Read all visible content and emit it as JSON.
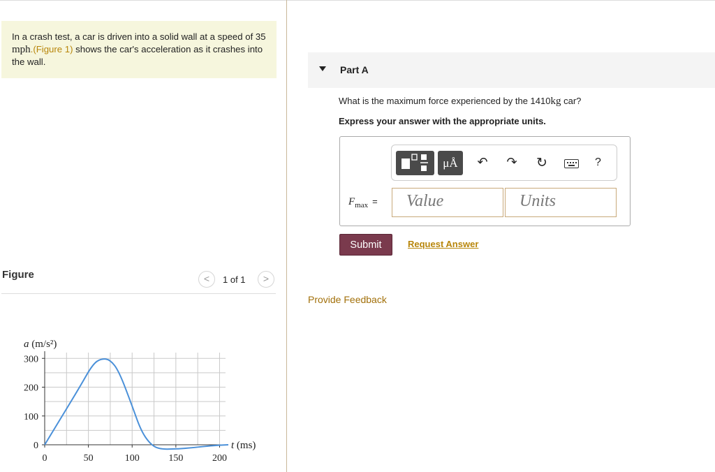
{
  "problem": {
    "text_part1": "In a crash test, a car is driven into a solid wall at a speed of 35 ",
    "speed_unit": "mph",
    "figure_link": ".(Figure 1)",
    "text_part2": " shows the car's acceleration as it crashes into the wall."
  },
  "figure": {
    "label": "Figure",
    "pager": "1 of 1",
    "prev_symbol": "<",
    "next_symbol": ">"
  },
  "part": {
    "title": "Part A",
    "question_pre": "What is the maximum force experienced by the 1410",
    "question_unit": "kg",
    "question_post": " car?",
    "instruction": "Express your answer with the appropriate units.",
    "units_button_label": "μÅ",
    "answer_symbol": "F",
    "answer_subscript": "max",
    "equals": "=",
    "value_placeholder": "Value",
    "units_placeholder": "Units",
    "submit_label": "Submit",
    "request_label": "Request Answer",
    "help_label": "?"
  },
  "feedback_label": "Provide Feedback",
  "chart_data": {
    "type": "line",
    "ylabel_var": "a",
    "ylabel_unit": "(m/s²)",
    "xlabel_var": "t",
    "xlabel_unit": "(ms)",
    "xlim": [
      0,
      210
    ],
    "ylim": [
      0,
      320
    ],
    "x_ticks": [
      0,
      50,
      100,
      150,
      200
    ],
    "y_ticks": [
      0,
      100,
      200,
      300
    ],
    "grid": true,
    "color": "#4a90d9",
    "series": [
      {
        "x": [
          0,
          20,
          40,
          55,
          65,
          75,
          85,
          100,
          110,
          120,
          130,
          150,
          170,
          190,
          210
        ],
        "y": [
          0,
          100,
          200,
          280,
          300,
          295,
          255,
          135,
          50,
          5,
          -15,
          -15,
          -10,
          -3,
          0
        ]
      }
    ]
  }
}
